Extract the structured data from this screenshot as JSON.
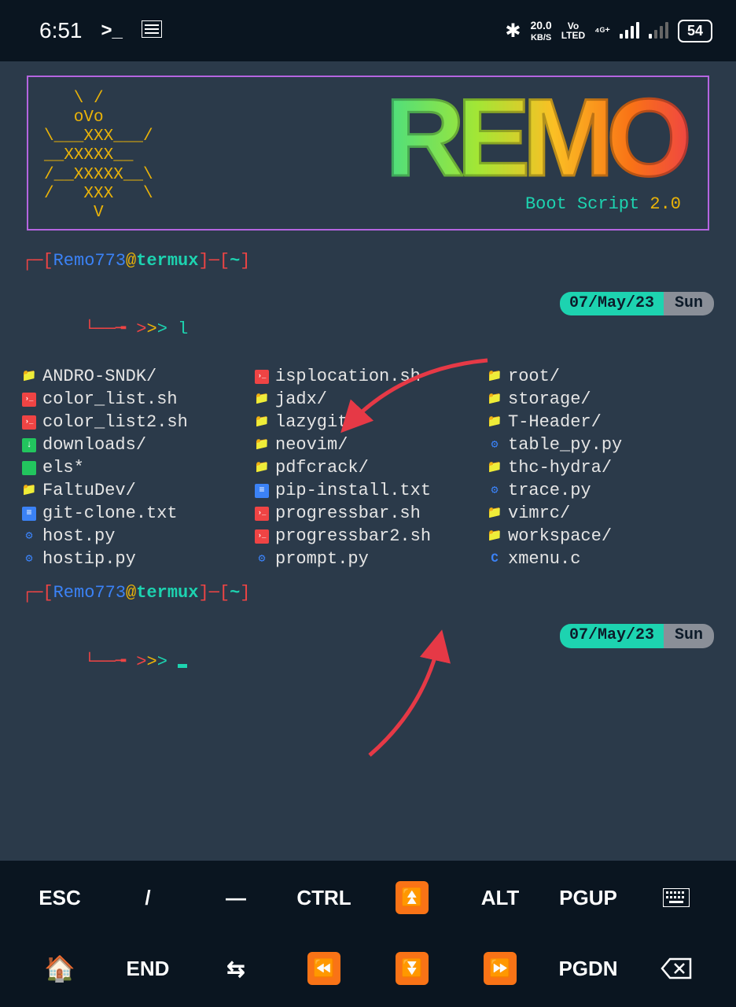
{
  "status": {
    "time": "6:51",
    "net_speed_top": "20.0",
    "net_speed_unit": "KB/S",
    "volte": "Vo\nLTED",
    "net_type": "4G+",
    "battery": "54"
  },
  "banner": {
    "bug_ascii": "   \\ /\n   oVo\n\\___XXX___/\n__XXXXX__\n/__XXXXX__\\\n/   XXX   \\\n     V",
    "logo": "REMO",
    "boot_text": "Boot Script",
    "version": "2.0"
  },
  "prompt": {
    "user": "Remo773",
    "host": "termux",
    "path": "~",
    "cmd": "l",
    "date": "07/May/23",
    "weekday": "Sun"
  },
  "files": {
    "col1": [
      {
        "icon": "dir",
        "name": "ANDRO-SNDK/"
      },
      {
        "icon": "sh",
        "name": "color_list.sh"
      },
      {
        "icon": "sh",
        "name": "color_list2.sh"
      },
      {
        "icon": "dl",
        "name": "downloads/"
      },
      {
        "icon": "exe",
        "name": "els*"
      },
      {
        "icon": "dir",
        "name": "FaltuDev/"
      },
      {
        "icon": "txt",
        "name": "git-clone.txt"
      },
      {
        "icon": "py",
        "name": "host.py"
      },
      {
        "icon": "py",
        "name": "hostip.py"
      }
    ],
    "col2": [
      {
        "icon": "sh",
        "name": "isplocation.sh"
      },
      {
        "icon": "dir",
        "name": "jadx/"
      },
      {
        "icon": "dir",
        "name": "lazygit/"
      },
      {
        "icon": "dir",
        "name": "neovim/"
      },
      {
        "icon": "dir",
        "name": "pdfcrack/"
      },
      {
        "icon": "txt",
        "name": "pip-install.txt"
      },
      {
        "icon": "sh",
        "name": "progressbar.sh"
      },
      {
        "icon": "sh",
        "name": "progressbar2.sh"
      },
      {
        "icon": "py",
        "name": "prompt.py"
      }
    ],
    "col3": [
      {
        "icon": "dir",
        "name": "root/"
      },
      {
        "icon": "dir",
        "name": "storage/"
      },
      {
        "icon": "dir",
        "name": "T-Header/"
      },
      {
        "icon": "py",
        "name": "table_py.py"
      },
      {
        "icon": "dir",
        "name": "thc-hydra/"
      },
      {
        "icon": "py",
        "name": "trace.py"
      },
      {
        "icon": "dir",
        "name": "vimrc/"
      },
      {
        "icon": "dir",
        "name": "workspace/"
      },
      {
        "icon": "c",
        "name": "xmenu.c"
      }
    ]
  },
  "kbd": {
    "row1": [
      "ESC",
      "/",
      "—",
      "CTRL",
      "UP2",
      "ALT",
      "PGUP",
      "KBD"
    ],
    "row2": [
      "HOME",
      "END",
      "SWAP",
      "PREV",
      "DOWN2",
      "NEXT",
      "PGDN",
      "BKSP"
    ]
  }
}
